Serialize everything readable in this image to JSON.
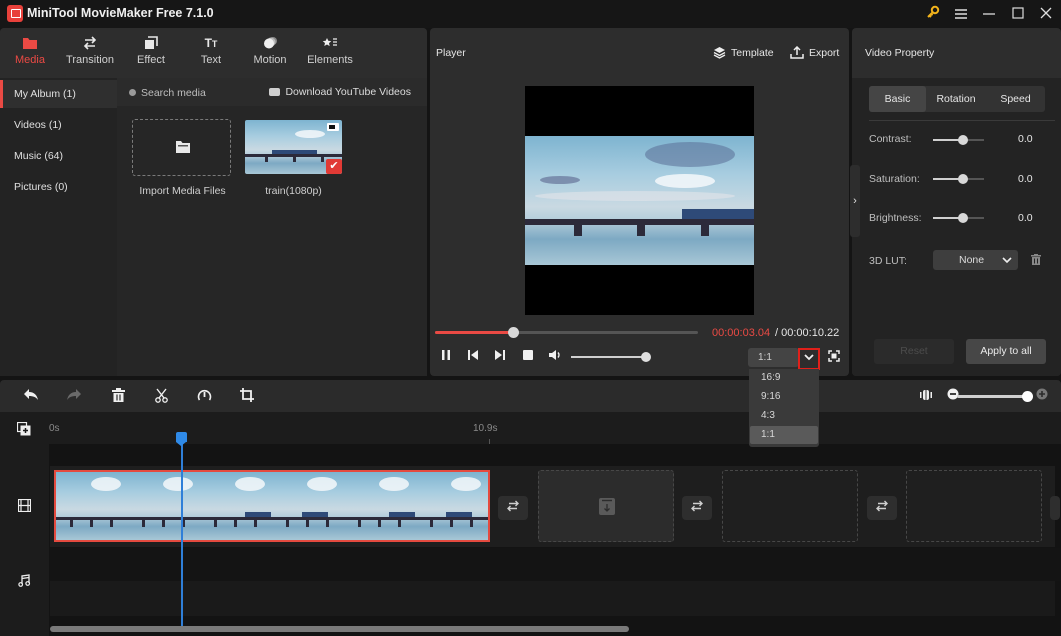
{
  "window": {
    "title": "MiniTool MovieMaker Free 7.1.0",
    "controls": [
      "key-icon",
      "menu-icon",
      "minimize-icon",
      "maximize-icon",
      "close-icon"
    ]
  },
  "media_tabs": [
    {
      "label": "Media",
      "icon": "folder-icon",
      "active": true
    },
    {
      "label": "Transition",
      "icon": "transition-icon",
      "active": false
    },
    {
      "label": "Effect",
      "icon": "effect-icon",
      "active": false
    },
    {
      "label": "Text",
      "icon": "text-icon",
      "active": false
    },
    {
      "label": "Motion",
      "icon": "motion-icon",
      "active": false
    },
    {
      "label": "Elements",
      "icon": "elements-icon",
      "active": false
    }
  ],
  "album": {
    "items": [
      {
        "label": "My Album (1)",
        "active": true
      },
      {
        "label": "Videos (1)",
        "active": false
      },
      {
        "label": "Music (64)",
        "active": false
      },
      {
        "label": "Pictures (0)",
        "active": false
      }
    ]
  },
  "media": {
    "search_placeholder": "Search media",
    "download_label": "Download YouTube Videos",
    "import_label": "Import Media Files",
    "items": [
      {
        "label": "train(1080p)",
        "type": "video",
        "selected": true
      }
    ]
  },
  "player": {
    "title": "Player",
    "template_label": "Template",
    "export_label": "Export",
    "progress_fraction": 0.297,
    "time_current": "00:00:03.04",
    "time_separator": " / ",
    "time_total": "00:00:10.22",
    "volume_fraction": 1.0,
    "aspect_ratio": "1:1",
    "aspect_options": [
      "16:9",
      "9:16",
      "4:3",
      "1:1"
    ],
    "aspect_selected": "1:1",
    "dropdown_icon": "chevron-down-icon"
  },
  "property": {
    "title": "Video Property",
    "tabs": [
      {
        "label": "Basic",
        "active": true
      },
      {
        "label": "Rotation",
        "active": false
      },
      {
        "label": "Speed",
        "active": false
      }
    ],
    "sliders": [
      {
        "label": "Contrast:",
        "value": "0.0",
        "fraction": 0.5
      },
      {
        "label": "Saturation:",
        "value": "0.0",
        "fraction": 0.5
      },
      {
        "label": "Brightness:",
        "value": "0.0",
        "fraction": 0.5
      }
    ],
    "lut_label": "3D LUT:",
    "lut_value": "None",
    "reset_label": "Reset",
    "apply_all_label": "Apply to all"
  },
  "timeline": {
    "toolbar": [
      "undo-icon",
      "redo-icon",
      "delete-icon",
      "split-icon",
      "speed-icon",
      "crop-icon"
    ],
    "zoom_fraction": 1.0,
    "ruler_labels": [
      "0s",
      "10.9s"
    ],
    "playhead_time": "00:00:03.04",
    "clip_frames": 6,
    "empty_slots": 3
  }
}
